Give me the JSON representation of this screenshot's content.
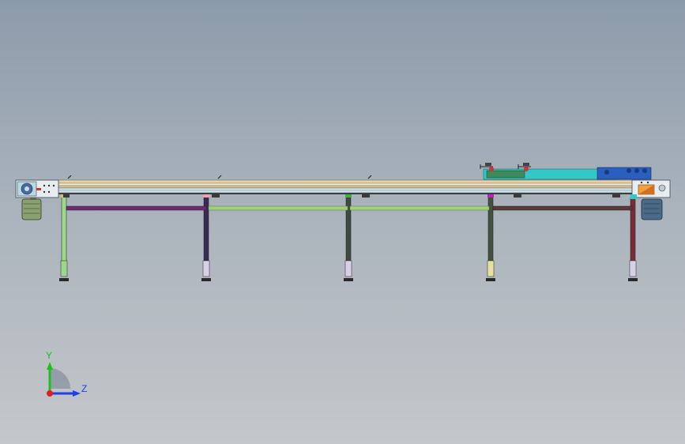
{
  "window": {
    "background_top": "#8c9bab",
    "background_bottom": "#c4c7cb"
  },
  "model": {
    "name_icon": "conveyor-assembly-model",
    "legs": [
      {
        "color": "#9bd88a"
      },
      {
        "color": "#3a2a55"
      },
      {
        "color": "#3c4a3f"
      },
      {
        "color": "#44533f"
      },
      {
        "color": "#7a2a38"
      }
    ],
    "brace_colors": [
      "#6a2e6e",
      "#9fd07a",
      "#5a3a3a"
    ],
    "accent_cyan": "#33c7c7",
    "accent_blue": "#2a5fbf",
    "accent_red": "#d83030"
  },
  "triad": {
    "y_label": "Y",
    "z_label": "Z",
    "y_color": "#1fbf1f",
    "z_color": "#2040e0",
    "x_color": "#e02020"
  }
}
